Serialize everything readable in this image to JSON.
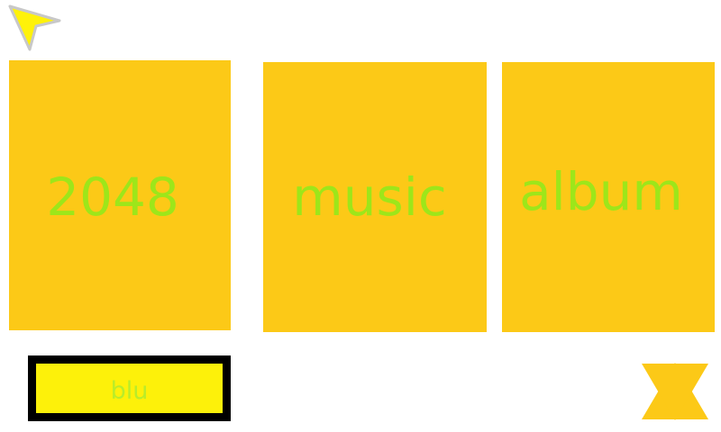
{
  "screen": {
    "background_color": "#ffffff"
  },
  "cursor": {
    "icon": "pointer-arrow-icon",
    "fill_color": "#fff20a",
    "outline_color": "#c8c8c8"
  },
  "tiles": [
    {
      "label": "2048",
      "icon": "",
      "bg_color": "#fcc917",
      "text_color": "#9de61a"
    },
    {
      "label": "music",
      "icon": "",
      "bg_color": "#fcc917",
      "text_color": "#9de61a"
    },
    {
      "label": "album",
      "icon": "",
      "bg_color": "#fcc917",
      "text_color": "#9de61a"
    }
  ],
  "bottom_button": {
    "label": "blu",
    "bg_color": "#fdf10a",
    "border_color": "#000000",
    "text_color": "#b9ec2a"
  },
  "corner_star": {
    "icon": "six-point-star-icon",
    "color": "#fcc917"
  }
}
